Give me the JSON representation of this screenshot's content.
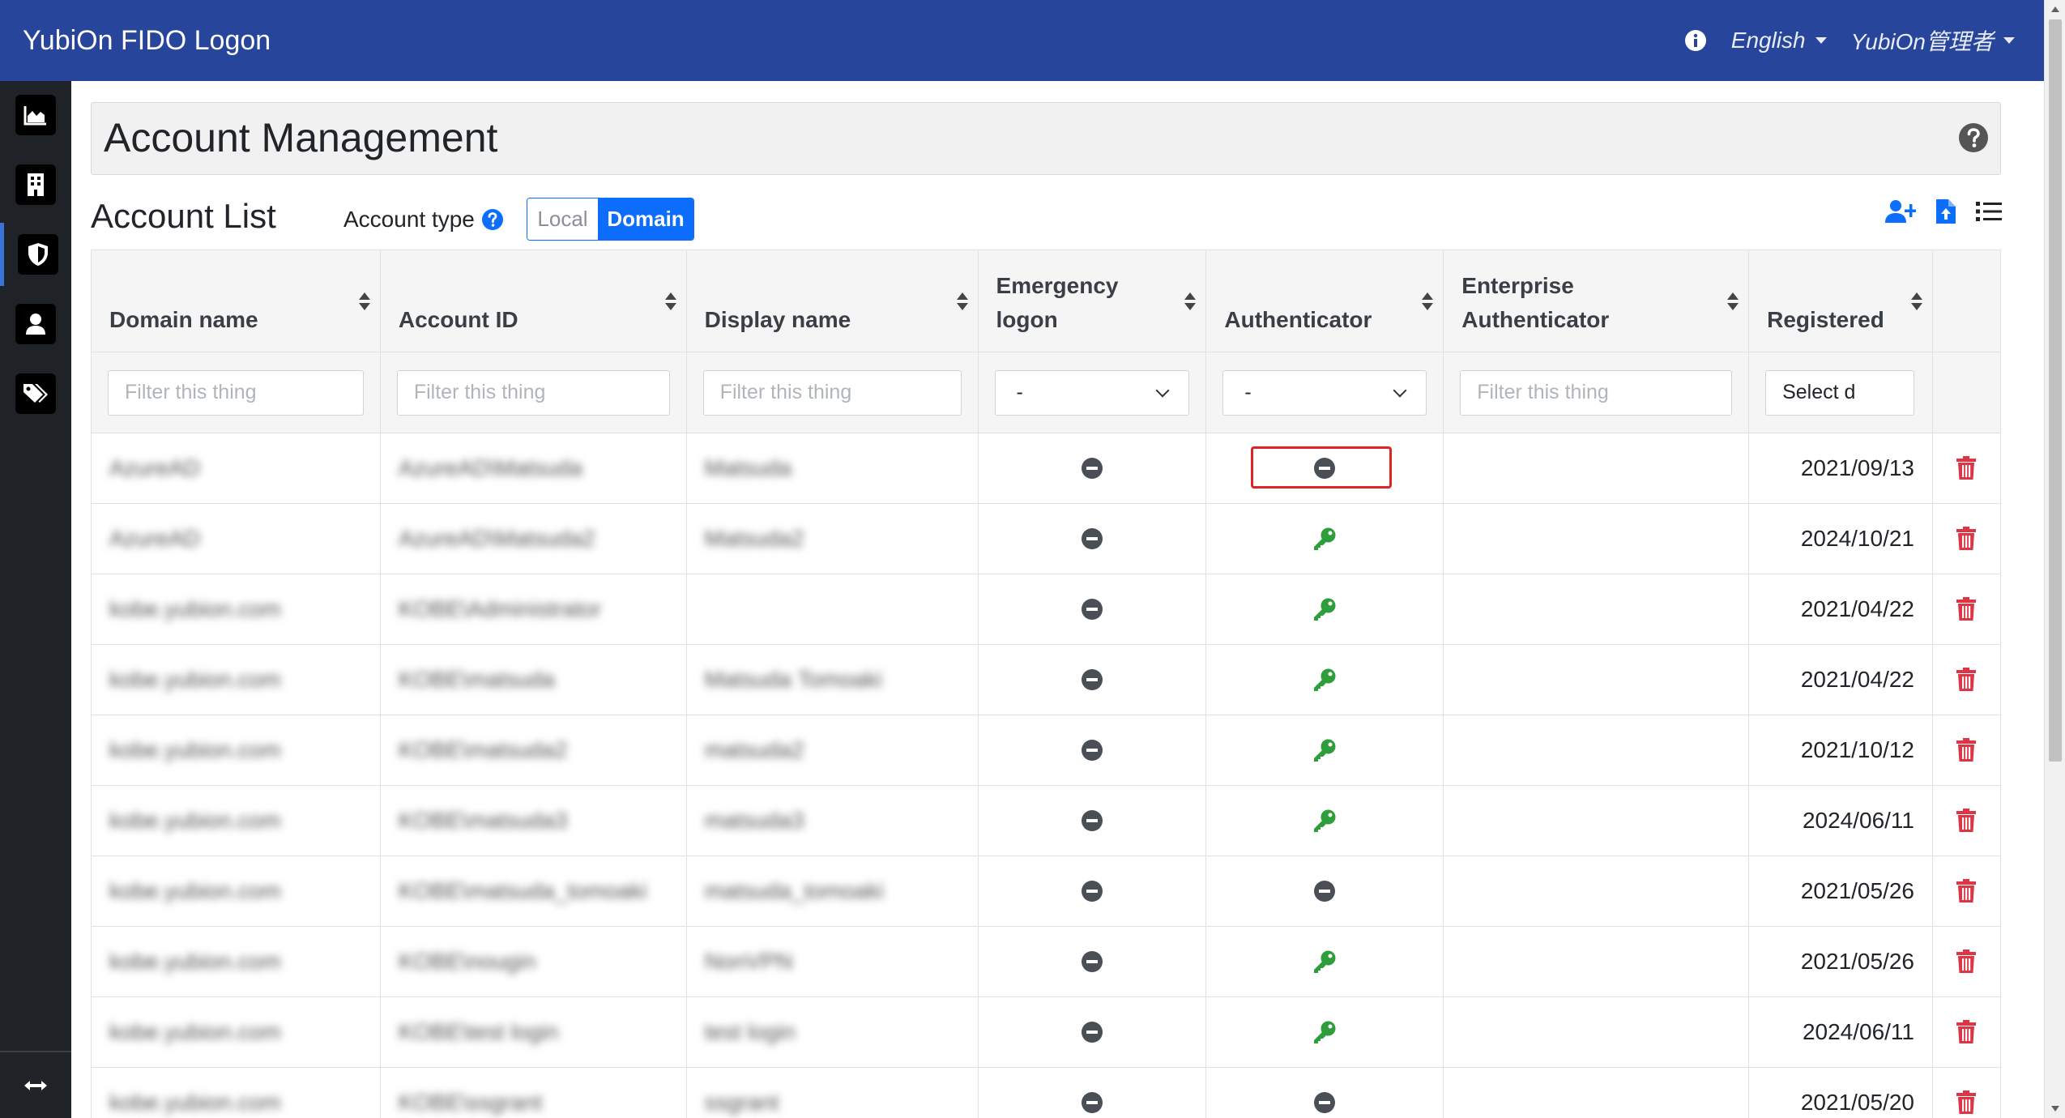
{
  "navbar": {
    "brand": "YubiOn FIDO Logon",
    "language": "English",
    "user": "YubiOn管理者"
  },
  "sidebar": {
    "items": [
      {
        "icon": "chart-area-icon"
      },
      {
        "icon": "building-icon"
      },
      {
        "icon": "shield-icon",
        "active": true
      },
      {
        "icon": "user-icon"
      },
      {
        "icon": "tags-icon"
      }
    ],
    "bottom_icon": "arrows-horizontal-icon"
  },
  "page": {
    "title": "Account Management"
  },
  "list": {
    "title": "Account List",
    "account_type_label": "Account type",
    "toggle": {
      "local": "Local",
      "domain": "Domain",
      "selected": "Domain"
    }
  },
  "table": {
    "headers": {
      "domain_name": "Domain name",
      "account_id": "Account ID",
      "display_name": "Display name",
      "emergency_line1": "Emergency",
      "emergency_line2": "logon",
      "authenticator": "Authenticator",
      "enterprise_line1": "Enterprise",
      "enterprise_line2": "Authenticator",
      "registered": "Registered"
    },
    "filters": {
      "text_placeholder": "Filter this thing",
      "select_value": "-",
      "date_placeholder": "Select d"
    },
    "rows": [
      {
        "domain": "AzureAD",
        "account": "AzureAD\\Matsuda",
        "display": "Matsuda",
        "auth": "minus",
        "registered": "2021/09/13"
      },
      {
        "domain": "AzureAD",
        "account": "AzureAD\\Matsuda2",
        "display": "Matsuda2",
        "auth": "key",
        "registered": "2024/10/21"
      },
      {
        "domain": "kobe.yubion.com",
        "account": "KOBE\\Administrator",
        "display": "",
        "auth": "key",
        "registered": "2021/04/22"
      },
      {
        "domain": "kobe.yubion.com",
        "account": "KOBE\\matsuda",
        "display": "Matsuda Tomoaki",
        "auth": "key",
        "registered": "2021/04/22"
      },
      {
        "domain": "kobe.yubion.com",
        "account": "KOBE\\matsuda2",
        "display": "matsuda2",
        "auth": "key",
        "registered": "2021/10/12"
      },
      {
        "domain": "kobe.yubion.com",
        "account": "KOBE\\matsuda3",
        "display": "matsuda3",
        "auth": "key",
        "registered": "2024/06/11"
      },
      {
        "domain": "kobe.yubion.com",
        "account": "KOBE\\matsuda_tomoaki",
        "display": "matsuda_tomoaki",
        "auth": "minus",
        "registered": "2021/05/26"
      },
      {
        "domain": "kobe.yubion.com",
        "account": "KOBE\\nougin",
        "display": "NonVPN",
        "auth": "key",
        "registered": "2021/05/26"
      },
      {
        "domain": "kobe.yubion.com",
        "account": "KOBE\\test login",
        "display": "test login",
        "auth": "key",
        "registered": "2024/06/11"
      },
      {
        "domain": "kobe.yubion.com",
        "account": "KOBE\\ssgrant",
        "display": "ssgrant",
        "auth": "minus",
        "registered": "2021/05/20"
      }
    ]
  },
  "colors": {
    "navbar": "#27469b",
    "primary": "#0d6efd",
    "key_green": "#2e9e3a",
    "delete_red": "#dc3545"
  }
}
